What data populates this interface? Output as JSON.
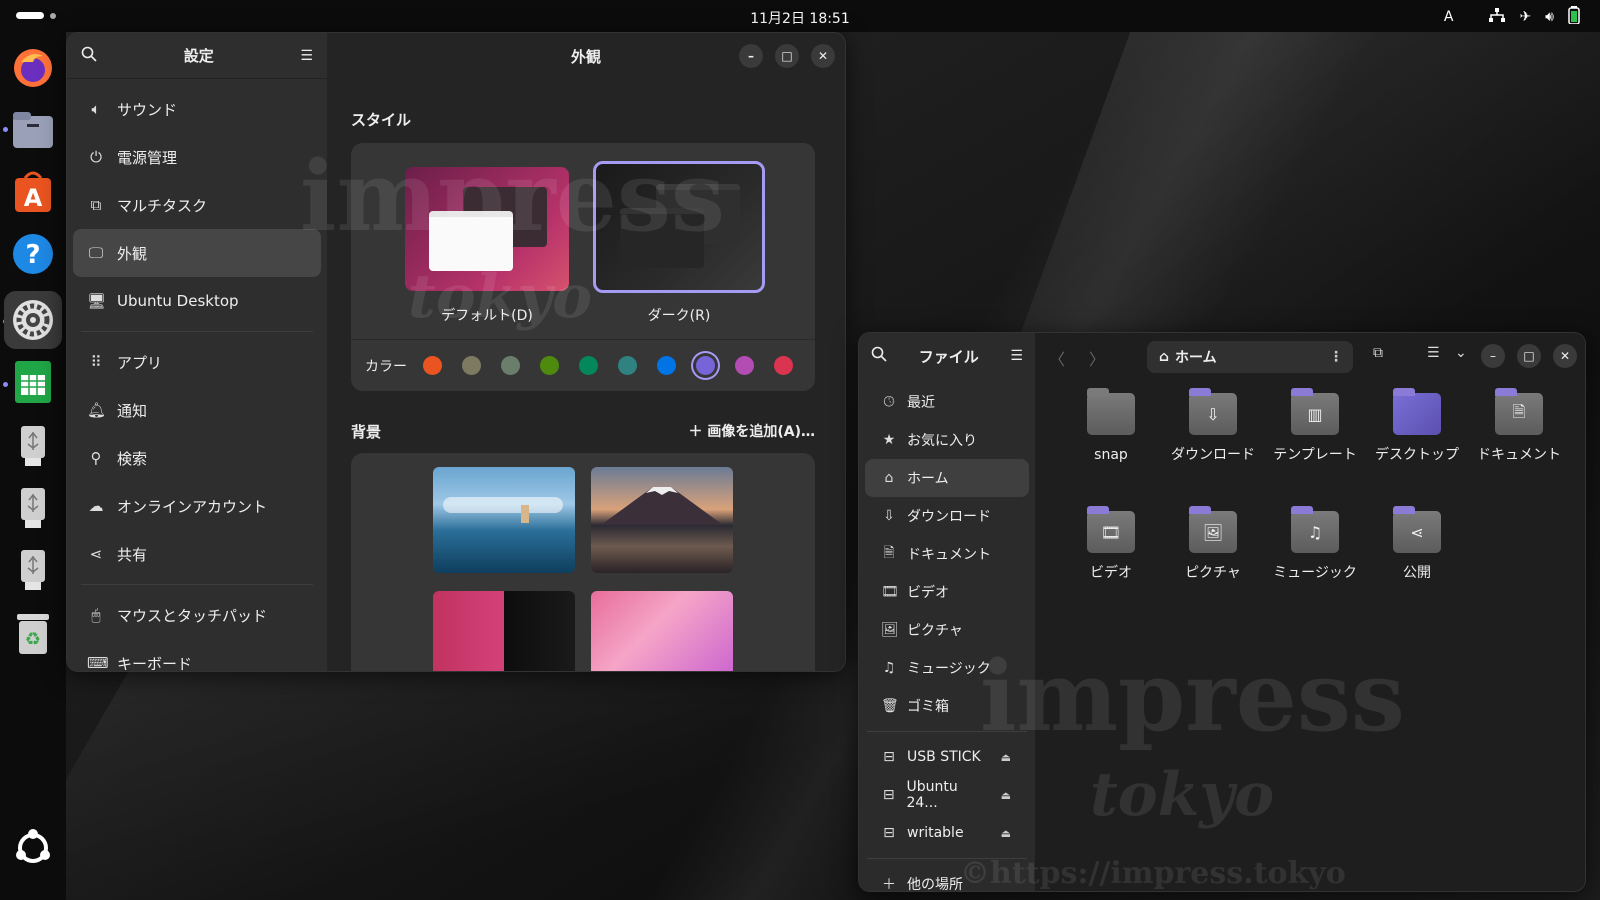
{
  "topbar": {
    "clock": "11月2日  18:51",
    "ime": "A"
  },
  "dock": {
    "apps": [
      {
        "name": "firefox-icon"
      },
      {
        "name": "files-icon"
      },
      {
        "name": "app-center-icon"
      },
      {
        "name": "help-icon"
      },
      {
        "name": "settings-icon"
      },
      {
        "name": "calc-icon"
      },
      {
        "name": "usb-drive-icon"
      },
      {
        "name": "usb-drive-icon"
      },
      {
        "name": "usb-drive-icon"
      },
      {
        "name": "trash-icon"
      },
      {
        "name": "show-apps-icon"
      }
    ]
  },
  "settings": {
    "sidebar_title": "設定",
    "page_title": "外観",
    "items": [
      {
        "label": "サウンド",
        "icon": "speaker-icon"
      },
      {
        "label": "電源管理",
        "icon": "power-icon"
      },
      {
        "label": "マルチタスク",
        "icon": "multitask-icon"
      },
      {
        "label": "外観",
        "icon": "appearance-icon"
      },
      {
        "label": "Ubuntu Desktop",
        "icon": "ubuntu-desktop-icon"
      },
      {
        "label": "アプリ",
        "icon": "apps-icon"
      },
      {
        "label": "通知",
        "icon": "bell-icon"
      },
      {
        "label": "検索",
        "icon": "search-icon"
      },
      {
        "label": "オンラインアカウント",
        "icon": "cloud-icon"
      },
      {
        "label": "共有",
        "icon": "share-icon"
      },
      {
        "label": "マウスとタッチパッド",
        "icon": "mouse-icon"
      },
      {
        "label": "キーボード",
        "icon": "keyboard-icon"
      }
    ],
    "style_title": "スタイル",
    "style_default": "デフォルト(D)",
    "style_dark": "ダーク(R)",
    "selected_style": "dark",
    "color_label": "カラー",
    "colors": [
      "#e95420",
      "#7e7a62",
      "#6b7d6b",
      "#4e8a0d",
      "#03875b",
      "#308280",
      "#0073e5",
      "#7764d8",
      "#b34cb3",
      "#da3450"
    ],
    "selected_color": "#7764d8",
    "background_title": "背景",
    "add_image": "画像を追加(A)…"
  },
  "files": {
    "sidebar_title": "ファイル",
    "path": "ホーム",
    "places": [
      {
        "label": "最近",
        "icon": "clock-icon"
      },
      {
        "label": "お気に入り",
        "icon": "star-icon"
      },
      {
        "label": "ホーム",
        "icon": "home-icon"
      },
      {
        "label": "ダウンロード",
        "icon": "download-icon"
      },
      {
        "label": "ドキュメント",
        "icon": "document-icon"
      },
      {
        "label": "ビデオ",
        "icon": "video-icon"
      },
      {
        "label": "ピクチャ",
        "icon": "picture-icon"
      },
      {
        "label": "ミュージック",
        "icon": "music-icon"
      },
      {
        "label": "ゴミ箱",
        "icon": "trash-icon"
      }
    ],
    "devices": [
      {
        "label": "USB STICK"
      },
      {
        "label": "Ubuntu 24..."
      },
      {
        "label": "writable"
      }
    ],
    "other_places": "他の場所",
    "folders": [
      {
        "label": "snap",
        "icon": "folder-icon"
      },
      {
        "label": "ダウンロード",
        "icon": "download-folder-icon"
      },
      {
        "label": "テンプレート",
        "icon": "templates-folder-icon"
      },
      {
        "label": "デスクトップ",
        "icon": "desktop-folder-icon"
      },
      {
        "label": "ドキュメント",
        "icon": "documents-folder-icon"
      },
      {
        "label": "ビデオ",
        "icon": "videos-folder-icon"
      },
      {
        "label": "ピクチャ",
        "icon": "pictures-folder-icon"
      },
      {
        "label": "ミュージック",
        "icon": "music-folder-icon"
      },
      {
        "label": "公開",
        "icon": "public-folder-icon"
      }
    ]
  },
  "watermark": {
    "line1": "impress",
    "line2": "tokyo",
    "url": "©https://impress.tokyo"
  }
}
